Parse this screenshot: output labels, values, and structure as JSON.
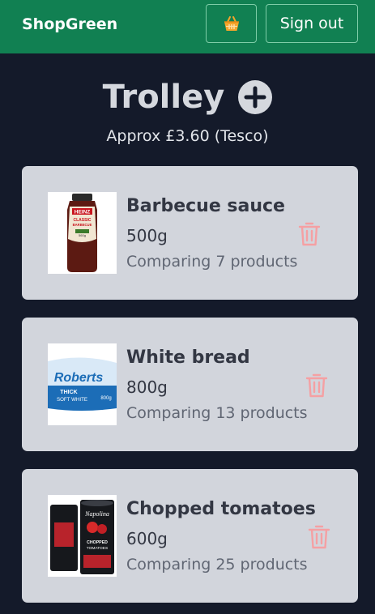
{
  "header": {
    "brand": "ShopGreen",
    "basket_icon": "basket-icon",
    "signout_label": "Sign out"
  },
  "page": {
    "title": "Trolley",
    "add_icon": "plus-circle-icon",
    "approx": "Approx £3.60 (Tesco)"
  },
  "items": [
    {
      "name": "Barbecue sauce",
      "size": "500g",
      "comparing": "Comparing 7 products",
      "image_icon": "heinz-bbq-sauce-bottle",
      "image_text": [
        "HEINZ",
        "CLASSIC",
        "BARBECUE",
        "560g"
      ]
    },
    {
      "name": "White bread",
      "size": "800g",
      "comparing": "Comparing 13 products",
      "image_icon": "roberts-bread-loaf",
      "image_text": [
        "Roberts",
        "THICK",
        "SOFT WHITE",
        "800g"
      ]
    },
    {
      "name": "Chopped tomatoes",
      "size": "600g",
      "comparing": "Comparing 25 products",
      "image_icon": "napolina-tomato-cans",
      "image_text": [
        "Napolina",
        "CHOPPED",
        "TOMATOES"
      ]
    }
  ],
  "colors": {
    "header_bg": "#118052",
    "page_bg": "#141a2a",
    "card_bg": "#d2d5dc",
    "delete_icon": "#f5a0a3",
    "basket": "#f4a52b"
  }
}
